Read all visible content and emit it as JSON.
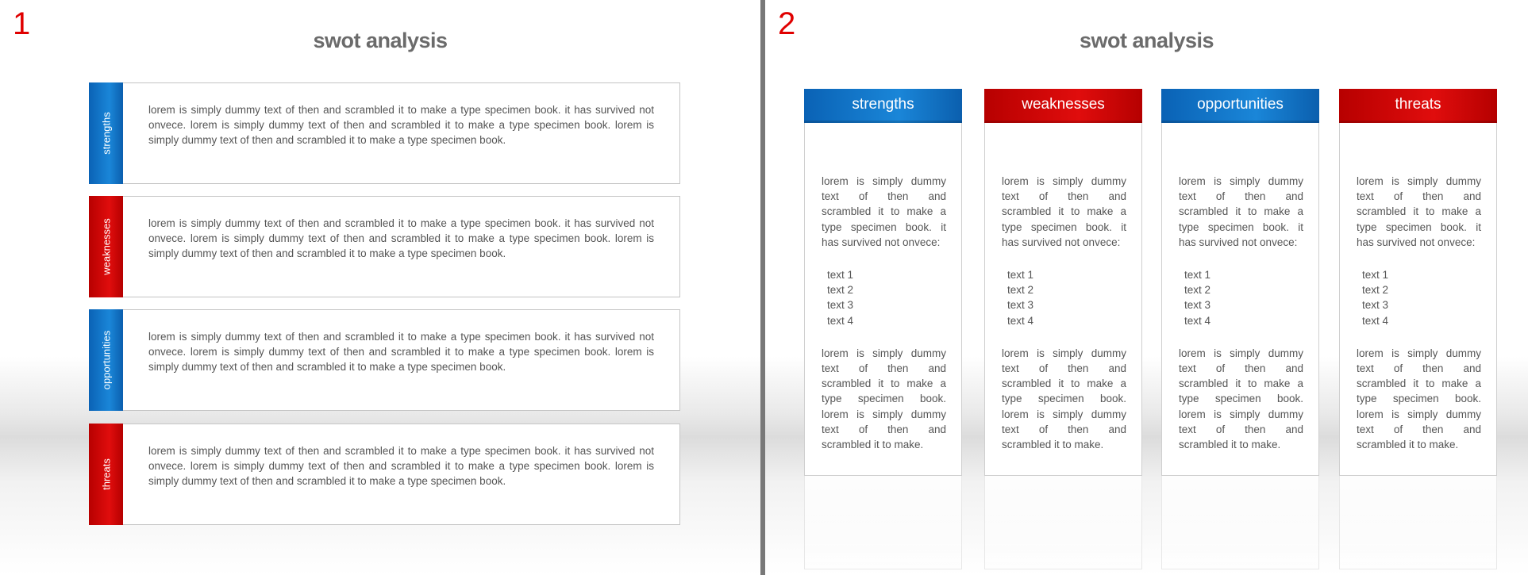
{
  "slide1": {
    "number": "1",
    "title": "swot analysis",
    "rows": [
      {
        "label": "strengths",
        "color": "#0a6fc6",
        "text": "lorem is simply dummy text of then and scrambled it to make a type specimen book. it has survived not onvece. lorem is simply dummy text of then and scrambled it to make a type specimen book. lorem is simply dummy text of then and scrambled it to make a type specimen book."
      },
      {
        "label": "weaknesses",
        "color": "#d00000",
        "text": "lorem is simply dummy text of then and scrambled it to make a type specimen book. it has survived not onvece. lorem is simply dummy text of then and scrambled it to make a type specimen book. lorem is simply dummy text of then and scrambled it to make a type specimen book."
      },
      {
        "label": "opportunities",
        "color": "#0a6fc6",
        "text": "lorem is simply dummy text of then and scrambled it to make a type specimen book. it has survived not onvece. lorem is simply dummy text of then and scrambled it to make a type specimen book. lorem is simply dummy text of then and scrambled it to make a type specimen book."
      },
      {
        "label": "threats",
        "color": "#d00000",
        "text": "lorem is simply dummy text of then and scrambled it to make a type specimen book. it has survived not onvece. lorem is simply dummy text of then and scrambled it to make a type specimen book. lorem is simply dummy text of then and scrambled it to make a type specimen book."
      }
    ]
  },
  "slide2": {
    "number": "2",
    "title": "swot analysis",
    "columns": [
      {
        "label": "strengths",
        "color": "#0a6fc6",
        "intro": "lorem is simply dummy text of then and scrambled it to make a type specimen book. it has survived not onvece:",
        "items": [
          "text 1",
          "text 2",
          "text 3",
          "text 4"
        ],
        "outro": "lorem is simply dummy text of then and scrambled it to make a type specimen book. lorem is simply dummy text of then and scrambled it to make."
      },
      {
        "label": "weaknesses",
        "color": "#d00000",
        "intro": "lorem is simply dummy text of then and scrambled it to make a type specimen book. it has survived not onvece:",
        "items": [
          "text 1",
          "text 2",
          "text 3",
          "text 4"
        ],
        "outro": "lorem is simply dummy text of then and scrambled it to make a type specimen book. lorem is simply dummy text of then and scrambled it to make."
      },
      {
        "label": "opportunities",
        "color": "#0a6fc6",
        "intro": "lorem is simply dummy text of then and scrambled it to make a type specimen book. it has survived not onvece:",
        "items": [
          "text 1",
          "text 2",
          "text 3",
          "text 4"
        ],
        "outro": "lorem is simply dummy text of then and scrambled it to make a type specimen book. lorem is simply dummy text of then and scrambled it to make."
      },
      {
        "label": "threats",
        "color": "#d00000",
        "intro": "lorem is simply dummy text of then and scrambled it to make a type specimen book. it has survived not onvece:",
        "items": [
          "text 1",
          "text 2",
          "text 3",
          "text 4"
        ],
        "outro": "lorem is simply dummy text of then and scrambled it to make a type specimen book. lorem is simply dummy text of then and scrambled it to make."
      }
    ]
  }
}
